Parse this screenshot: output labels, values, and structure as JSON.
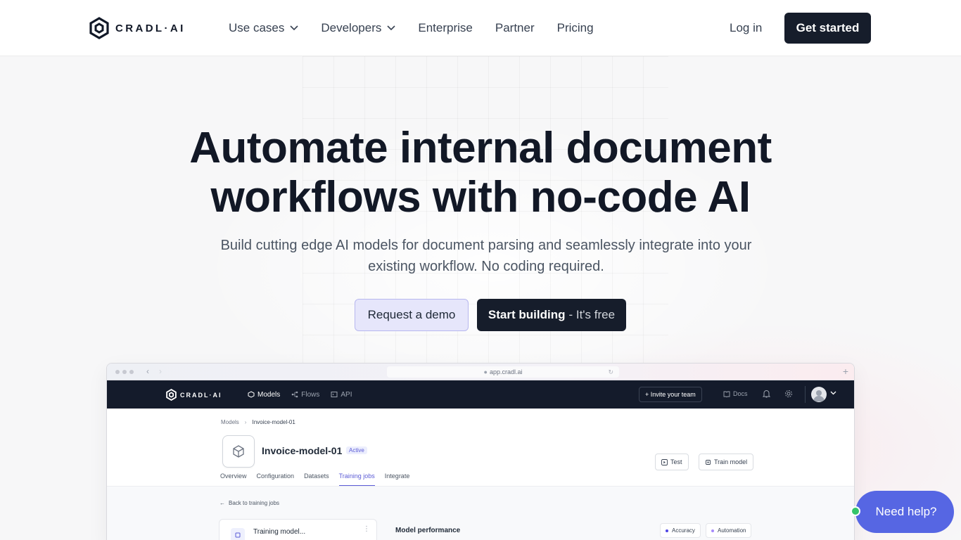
{
  "nav": {
    "logo_text": "CRADL·AI",
    "links": [
      {
        "label": "Use cases",
        "dropdown": true
      },
      {
        "label": "Developers",
        "dropdown": true
      },
      {
        "label": "Enterprise",
        "dropdown": false
      },
      {
        "label": "Partner",
        "dropdown": false
      },
      {
        "label": "Pricing",
        "dropdown": false
      }
    ],
    "login": "Log in",
    "cta": "Get started"
  },
  "hero": {
    "headline_line1": "Automate internal document",
    "headline_line2": "workflows with no-code AI",
    "subhead_line1": "Build cutting edge AI models for document parsing and seamlessly integrate into your",
    "subhead_line2": "existing workflow. No coding required.",
    "btn_demo": "Request a demo",
    "btn_build": "Start building",
    "btn_build_suffix": "- It's free"
  },
  "mockup": {
    "url": "app.cradl.ai",
    "app_logo_text": "CRADL·AI",
    "menu": [
      {
        "label": "Models",
        "active": true
      },
      {
        "label": "Flows",
        "active": false
      },
      {
        "label": "API",
        "active": false
      }
    ],
    "invite": "+ Invite your team",
    "docs": "Docs",
    "breadcrumb": {
      "root": "Models",
      "current": "Invoice-model-01"
    },
    "model_title": "Invoice-model-01",
    "status": "Active",
    "tabs": [
      "Overview",
      "Configuration",
      "Datasets",
      "Training jobs",
      "Integrate"
    ],
    "active_tab": "Training jobs",
    "btn_test": "Test",
    "btn_train": "Train model",
    "back_link": "Back to training jobs",
    "training_card_title": "Training model...",
    "performance_title": "Model performance",
    "legend": [
      {
        "label": "Accuracy",
        "color": "#4f46e5"
      },
      {
        "label": "Automation",
        "color": "#a78bfa"
      }
    ]
  },
  "help": {
    "label": "Need help?",
    "status_color": "#35c46a"
  },
  "colors": {
    "primary_dark": "#161d2b",
    "accent": "#5666e3",
    "demo_bg": "#e6e6fb"
  }
}
